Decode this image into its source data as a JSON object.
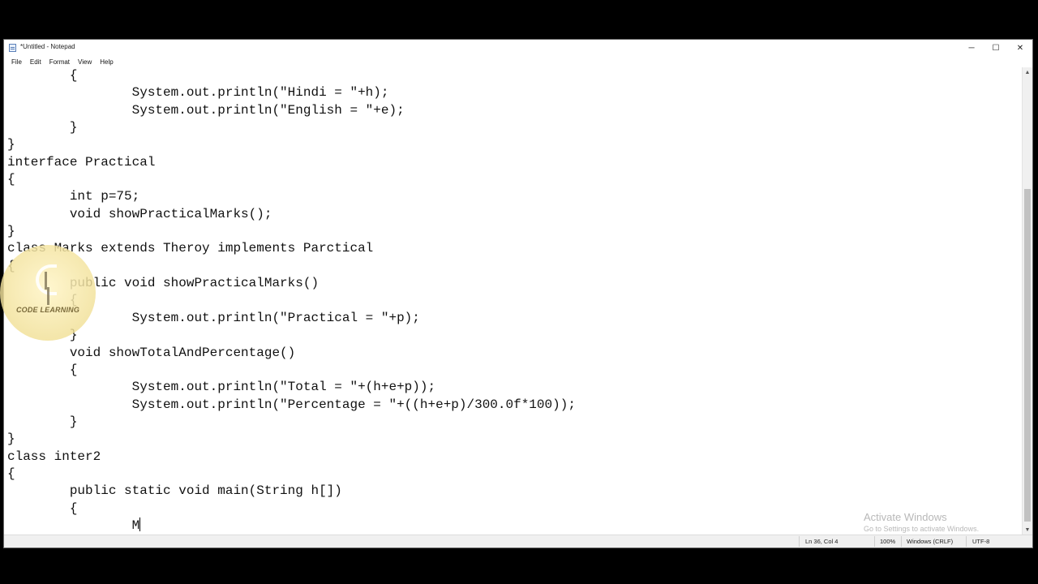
{
  "window": {
    "title": "*Untitled - Notepad",
    "controls": {
      "minimize": "─",
      "maximize": "☐",
      "close": "✕"
    }
  },
  "menubar": {
    "items": [
      "File",
      "Edit",
      "Format",
      "View",
      "Help"
    ]
  },
  "editor": {
    "text": "        {\n                System.out.println(\"Hindi = \"+h);\n                System.out.println(\"English = \"+e);\n        }\n}\ninterface Practical\n{\n        int p=75;\n        void showPracticalMarks();\n}\nclass Marks extends Theroy implements Parctical\n{\n        public void showPracticalMarks()\n        {\n                System.out.println(\"Practical = \"+p);\n        }\n        void showTotalAndPercentage()\n        {\n                System.out.println(\"Total = \"+(h+e+p));\n                System.out.println(\"Percentage = \"+((h+e+p)/300.0f*100));\n        }\n}\nclass inter2\n{\n        public static void main(String h[])\n        {\n                M"
  },
  "statusbar": {
    "position": "Ln 36, Col 4",
    "zoom": "100%",
    "line_ending": "Windows (CRLF)",
    "encoding": "UTF-8"
  },
  "watermark": {
    "line1": "Activate Windows",
    "line2": "Go to Settings to activate Windows."
  },
  "logo": {
    "text": "CODE LEARNING"
  },
  "colors": {
    "background": "#000000",
    "window": "#ffffff",
    "statusbar": "#f0f0f0"
  }
}
